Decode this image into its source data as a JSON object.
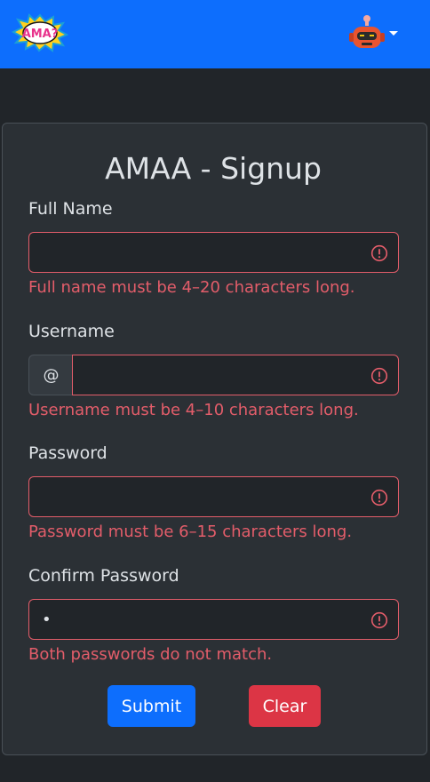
{
  "header": {
    "logo_text": "AMA?",
    "avatar_icon": "robot-avatar-icon",
    "menu_icon": "caret-down-icon",
    "background": "#0d6efd"
  },
  "form": {
    "title": "AMAA - Signup",
    "full_name": {
      "label": "Full Name",
      "value": "",
      "error": "Full name must be 4–20 characters long."
    },
    "username": {
      "label": "Username",
      "prefix": "@",
      "value": "",
      "error": "Username must be 4–10 characters long."
    },
    "password": {
      "label": "Password",
      "value": "",
      "error": "Password must be 6–15 characters long."
    },
    "confirm_password": {
      "label": "Confirm Password",
      "value": "•",
      "error": "Both passwords do not match."
    },
    "submit_label": "Submit",
    "clear_label": "Clear"
  },
  "colors": {
    "error": "#e35d6a",
    "primary": "#0d6efd",
    "danger": "#dc3545",
    "card": "#2b3035",
    "page": "#212529"
  }
}
